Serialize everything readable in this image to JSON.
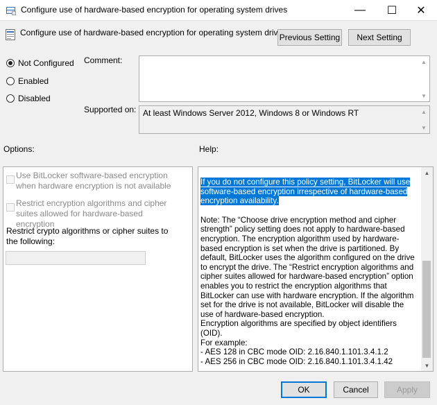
{
  "window": {
    "title": "Configure use of hardware-based encryption for operating system drives",
    "minimize_glyph": "—",
    "maximize_glyph": "☐",
    "close_glyph": "✕"
  },
  "header": {
    "policy_name": "Configure use of hardware-based encryption for operating system drives",
    "previous_label": "Previous Setting",
    "next_label": "Next Setting"
  },
  "state": {
    "options": [
      "Not Configured",
      "Enabled",
      "Disabled"
    ],
    "selected": "Not Configured"
  },
  "comment": {
    "label": "Comment:",
    "value": ""
  },
  "supported": {
    "label": "Supported on:",
    "value": "At least Windows Server 2012, Windows 8 or Windows RT"
  },
  "options_panel": {
    "label": "Options:",
    "items": [
      {
        "label": "Use BitLocker software-based encryption when hardware encryption is not available",
        "checked": false,
        "enabled": false
      },
      {
        "label": "Restrict encryption algorithms and cipher suites allowed for hardware-based encryption",
        "checked": false,
        "enabled": false
      }
    ],
    "restrict_label": "Restrict crypto algorithms or cipher suites to the following:",
    "restrict_value": ""
  },
  "help_panel": {
    "label": "Help:",
    "highlighted_text": "If you do not configure this policy setting, BitLocker will use software-based encryption irrespective of hardware-based encryption availability.",
    "body": "Note: The “Choose drive encryption method and cipher strength” policy setting does not apply to hardware-based encryption. The encryption algorithm used by hardware-based encryption is set when the drive is partitioned. By default, BitLocker uses the algorithm configured on the drive to encrypt the drive. The “Restrict encryption algorithms and cipher suites allowed for hardware-based encryption” option enables you to restrict the encryption algorithms that BitLocker can use with hardware encryption. If the algorithm set for the drive is not available, BitLocker will disable the use of hardware-based encryption.",
    "oid_intro": "Encryption algorithms are specified by object identifiers (OID).",
    "example_label": "For example:",
    "examples": [
      "- AES 128 in CBC mode OID: 2.16.840.1.101.3.4.1.2",
      "- AES 256 in CBC mode OID: 2.16.840.1.101.3.4.1.42"
    ]
  },
  "footer": {
    "ok_label": "OK",
    "cancel_label": "Cancel",
    "apply_label": "Apply"
  },
  "colors": {
    "selection": "#0078d7",
    "window_bg": "#f0f0f0",
    "disabled_text": "#8a8a8a"
  },
  "icons": {
    "title_icon": "policy-editor-icon",
    "header_icon": "policy-setting-icon"
  }
}
